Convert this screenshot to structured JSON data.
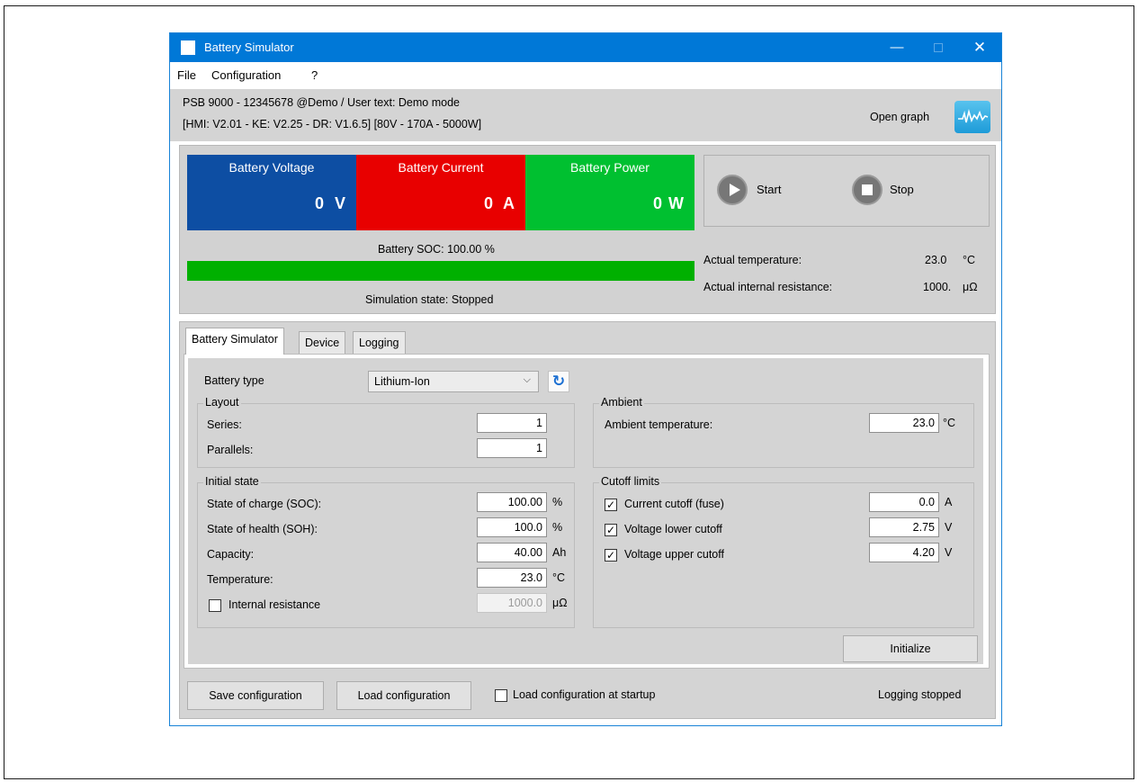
{
  "window": {
    "title": "Battery Simulator",
    "controls": {
      "minimize": "—",
      "close": "✕"
    }
  },
  "menu": [
    "File",
    "Configuration",
    "?"
  ],
  "info": {
    "line1": "PSB 9000 - 12345678 @Demo / User text: Demo mode",
    "line2": "[HMI: V2.01 - KE: V2.25 - DR: V1.6.5] [80V - 170A - 5000W]",
    "open_graph_label": "Open graph",
    "graph_icon": "waveform-icon"
  },
  "meters": {
    "voltage": {
      "title": "Battery Voltage",
      "value": "0",
      "unit": "V",
      "color": "#0d4ea3"
    },
    "current": {
      "title": "Battery Current",
      "value": "0",
      "unit": "A",
      "color": "#e80000"
    },
    "power": {
      "title": "Battery Power",
      "value": "0",
      "unit": "W",
      "color": "#00c030"
    }
  },
  "controls": {
    "start_label": "Start",
    "stop_label": "Stop"
  },
  "soc": {
    "label": "Battery SOC: 100.00 %",
    "fraction": 1.0,
    "color": "#00b000"
  },
  "simulation_state": "Simulation state: Stopped",
  "actual": {
    "temperature_label": "Actual temperature:",
    "temperature_value": "23.0",
    "temperature_unit": "°C",
    "resistance_label": "Actual internal resistance:",
    "resistance_value": "1000.",
    "resistance_unit": "μΩ"
  },
  "tabs": [
    "Battery Simulator",
    "Device",
    "Logging"
  ],
  "battery_type": {
    "label": "Battery type",
    "value": "Lithium-Ion",
    "reload_icon": "refresh-icon"
  },
  "layout_group": {
    "title": "Layout",
    "series_label": "Series:",
    "series_value": "1",
    "parallels_label": "Parallels:",
    "parallels_value": "1"
  },
  "ambient_group": {
    "title": "Ambient",
    "temp_label": "Ambient temperature:",
    "temp_value": "23.0",
    "temp_unit": "°C"
  },
  "initial_group": {
    "title": "Initial state",
    "soc_label": "State of charge (SOC):",
    "soc_value": "100.00",
    "soc_unit": "%",
    "soh_label": "State of health (SOH):",
    "soh_value": "100.0",
    "soh_unit": "%",
    "capacity_label": "Capacity:",
    "capacity_value": "40.00",
    "capacity_unit": "Ah",
    "temperature_label": "Temperature:",
    "temperature_value": "23.0",
    "temperature_unit": "°C",
    "resistance_label": "Internal resistance",
    "resistance_value": "1000.0",
    "resistance_unit": "μΩ",
    "resistance_checked": false
  },
  "cutoff_group": {
    "title": "Cutoff limits",
    "current_label": "Current cutoff (fuse)",
    "current_value": "0.0",
    "current_unit": "A",
    "current_checked": true,
    "vlow_label": "Voltage lower cutoff",
    "vlow_value": "2.75",
    "vlow_unit": "V",
    "vlow_checked": true,
    "vhigh_label": "Voltage upper cutoff",
    "vhigh_value": "4.20",
    "vhigh_unit": "V",
    "vhigh_checked": true
  },
  "initialize_label": "Initialize",
  "bottom": {
    "save_label": "Save configuration",
    "load_label": "Load configuration",
    "startup_label": "Load configuration at startup",
    "startup_checked": false,
    "logging_status": "Logging stopped"
  }
}
